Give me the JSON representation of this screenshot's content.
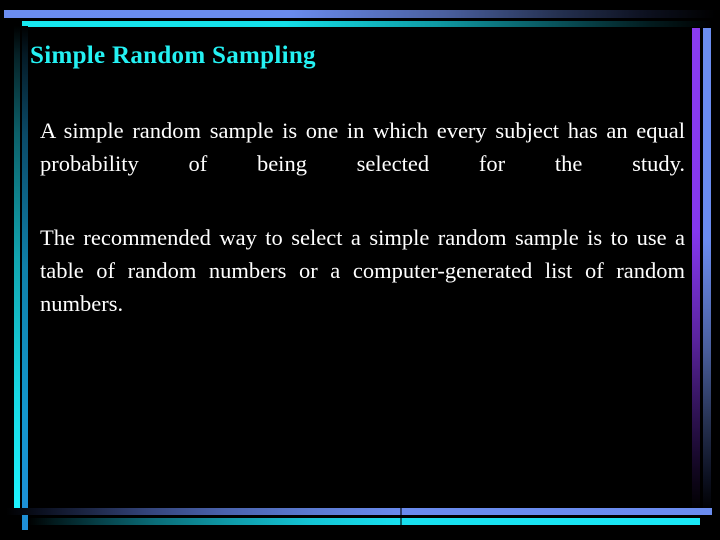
{
  "slide": {
    "title": "Simple Random Sampling",
    "paragraphs": [
      "A simple random sample is one in which every subject has an equal probability of  being  selected for the study.",
      "The recommended way to select a simple random sample is to use a table of random numbers or a computer-generated list of random numbers."
    ],
    "colors": {
      "background": "#000000",
      "title": "#24f1f3",
      "body_text": "#ffffff",
      "accent_cyan": "#1ef4ff",
      "accent_blue": "#6b8df0",
      "accent_purple": "#8a3cf0"
    }
  }
}
